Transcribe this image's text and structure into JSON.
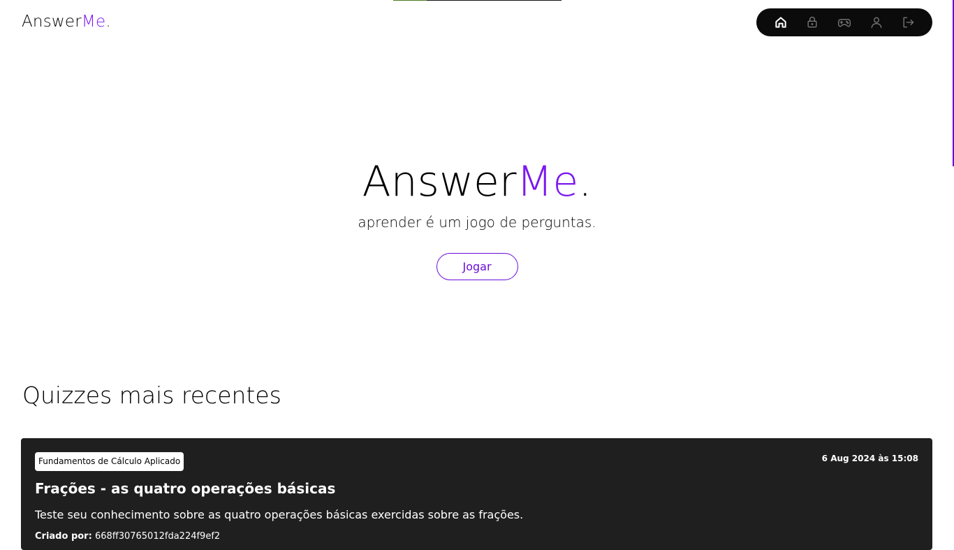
{
  "top_progress": {
    "value": 0.2
  },
  "header": {
    "logo_main": "Answer",
    "logo_accent": "Me",
    "logo_dot": "."
  },
  "nav": {
    "items": [
      {
        "icon": "home-icon",
        "active": true
      },
      {
        "icon": "lock-icon",
        "active": false
      },
      {
        "icon": "gamepad-icon",
        "active": false
      },
      {
        "icon": "user-icon",
        "active": false
      },
      {
        "icon": "logout-icon",
        "active": false
      }
    ]
  },
  "hero": {
    "title_main": "Answer",
    "title_accent": "Me",
    "title_dot": ".",
    "subtitle": "aprender é um jogo de perguntas.",
    "play_label": "Jogar"
  },
  "recent": {
    "title": "Quizzes mais recentes",
    "quizzes": [
      {
        "tag": "Fundamentos de Cálculo Aplicado",
        "date": "6 Aug 2024 às 15:08",
        "title": "Frações - as quatro operações básicas",
        "description": "Teste seu conhecimento sobre as quatro operações básicas exercidas sobre as frações.",
        "author_label": "Criado por:",
        "author_value": "668ff30765012fda224f9ef2"
      }
    ]
  },
  "colors": {
    "accent": "#7b18f0",
    "nav_bg": "#0b0b0b",
    "card_bg": "#1f1f1f",
    "button_border": "#6a0dd8"
  }
}
